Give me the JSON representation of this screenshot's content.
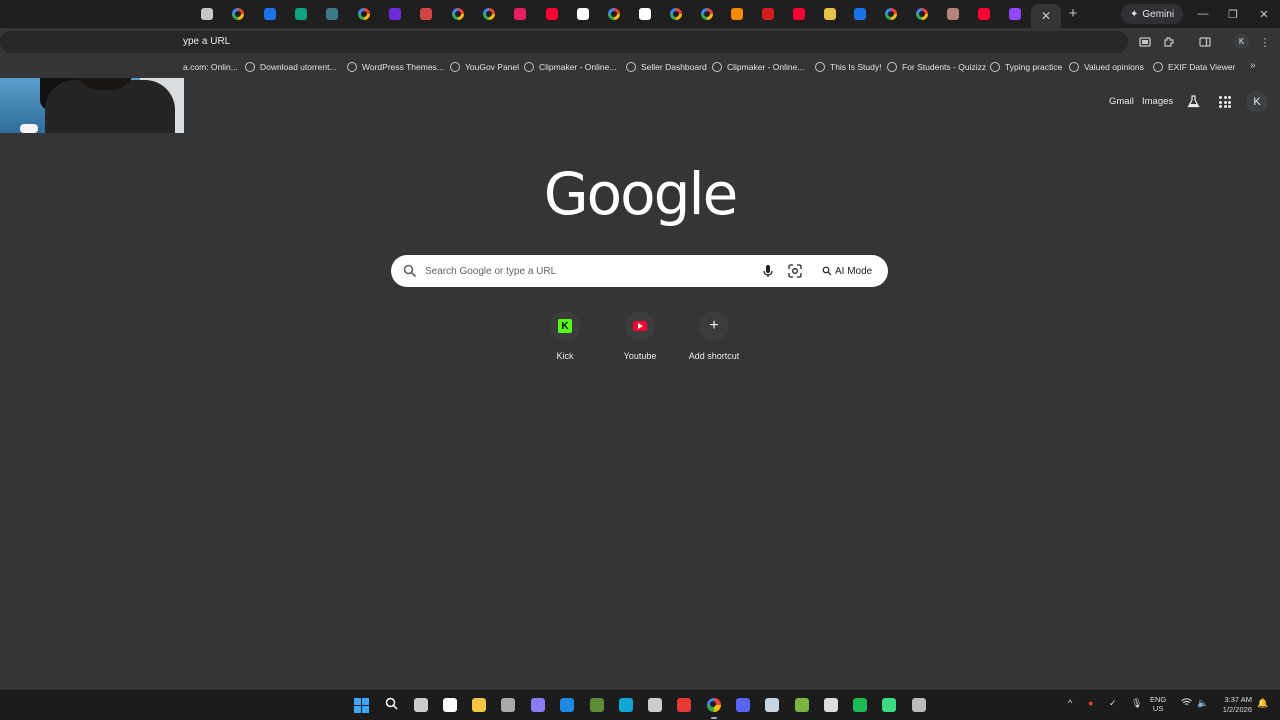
{
  "browser": {
    "tabs": [
      {
        "icon": "settings-icon",
        "color": "#c4c7c5"
      },
      {
        "icon": "google-icon",
        "color": "google"
      },
      {
        "icon": "outlook-icon",
        "color": "#1a73e8"
      },
      {
        "icon": "chatgpt-icon",
        "color": "#10a37f"
      },
      {
        "icon": "tm-icon",
        "color": "#3c7a89"
      },
      {
        "icon": "google-icon",
        "color": "google"
      },
      {
        "icon": "play-icon",
        "color": "#6f2bd9"
      },
      {
        "icon": "app-icon",
        "color": "#d04444"
      },
      {
        "icon": "google-icon",
        "color": "google"
      },
      {
        "icon": "google-icon",
        "color": "google"
      },
      {
        "icon": "s-icon",
        "color": "#e91e63"
      },
      {
        "icon": "youtube-icon",
        "color": "#ff0033"
      },
      {
        "icon": "doc-icon",
        "color": "#ffffff"
      },
      {
        "icon": "google-icon",
        "color": "google"
      },
      {
        "icon": "notion-icon",
        "color": "#ffffff"
      },
      {
        "icon": "google-icon",
        "color": "google"
      },
      {
        "icon": "google-icon",
        "color": "google"
      },
      {
        "icon": "vlc-icon",
        "color": "#f48b00"
      },
      {
        "icon": "red-icon",
        "color": "#d41b1b"
      },
      {
        "icon": "youtube-icon",
        "color": "#ff0033"
      },
      {
        "icon": "hammer-icon",
        "color": "#e8c34b"
      },
      {
        "icon": "outlook-icon",
        "color": "#1a73e8"
      },
      {
        "icon": "google-icon",
        "color": "google"
      },
      {
        "icon": "google-icon",
        "color": "google"
      },
      {
        "icon": "image-icon",
        "color": "#b5837a"
      },
      {
        "icon": "youtube-icon",
        "color": "#ff0033"
      },
      {
        "icon": "twitch-icon",
        "color": "#9146ff"
      }
    ],
    "active_tab_close": "✕",
    "new_tab": "+",
    "gemini_label": "Gemini",
    "window_controls": {
      "minimize": "—",
      "restore": "❐",
      "close": "✕"
    },
    "omnibox_text": "ype a URL",
    "profile_initial": "K"
  },
  "bookmarks": [
    {
      "label": "a.com: Onlin..."
    },
    {
      "label": "Download utorrent..."
    },
    {
      "label": "WordPress Themes..."
    },
    {
      "label": "YouGov Panel"
    },
    {
      "label": "Clipmaker - Online..."
    },
    {
      "label": "Seller Dashboard"
    },
    {
      "label": "Clipmaker - Online..."
    },
    {
      "label": "This Is Study!"
    },
    {
      "label": "For Students - Quizizz"
    },
    {
      "label": "Typing practice"
    },
    {
      "label": "Valued opinions"
    },
    {
      "label": "EXIF Data Viewer"
    }
  ],
  "header": {
    "gmail": "Gmail",
    "images": "Images",
    "avatar_initial": "K"
  },
  "logo_text": "Google",
  "search": {
    "placeholder": "Search Google or type a URL",
    "ai_mode_label": "AI Mode"
  },
  "shortcuts": [
    {
      "label": "Kick"
    },
    {
      "label": "Youtube"
    },
    {
      "label": "Add shortcut"
    }
  ],
  "taskbar": {
    "lang_top": "ENG",
    "lang_bottom": "US",
    "time": "3:37 AM",
    "date": "1/2/2026",
    "apps": [
      {
        "icon": "start-icon",
        "color": "#3ea6ff"
      },
      {
        "icon": "search-icon",
        "color": "#ffffff"
      },
      {
        "icon": "task-view-icon",
        "color": "#cccccc"
      },
      {
        "icon": "tiktok-icon",
        "color": "#ffffff"
      },
      {
        "icon": "file-explorer-icon",
        "color": "#f4c542"
      },
      {
        "icon": "app-icon",
        "color": "#aaaaaa"
      },
      {
        "icon": "game-controller-icon",
        "color": "#8b7cf6"
      },
      {
        "icon": "s-app-icon",
        "color": "#1e88e5"
      },
      {
        "icon": "minecraft-icon",
        "color": "#5d8c34"
      },
      {
        "icon": "edge-icon",
        "color": "#0fa8d6"
      },
      {
        "icon": "store-icon",
        "color": "#cccccc"
      },
      {
        "icon": "media-icon",
        "color": "#e53935"
      },
      {
        "icon": "chrome-icon",
        "color": "google"
      },
      {
        "icon": "discord-icon",
        "color": "#5865f2"
      },
      {
        "icon": "steam-icon",
        "color": "#c7d5e0"
      },
      {
        "icon": "xbox-icon",
        "color": "#7cb342"
      },
      {
        "icon": "app-icon",
        "color": "#dddddd"
      },
      {
        "icon": "spotify-icon",
        "color": "#1db954"
      },
      {
        "icon": "android-icon",
        "color": "#3ddc84"
      },
      {
        "icon": "settings-icon",
        "color": "#bbbbbb"
      }
    ]
  }
}
